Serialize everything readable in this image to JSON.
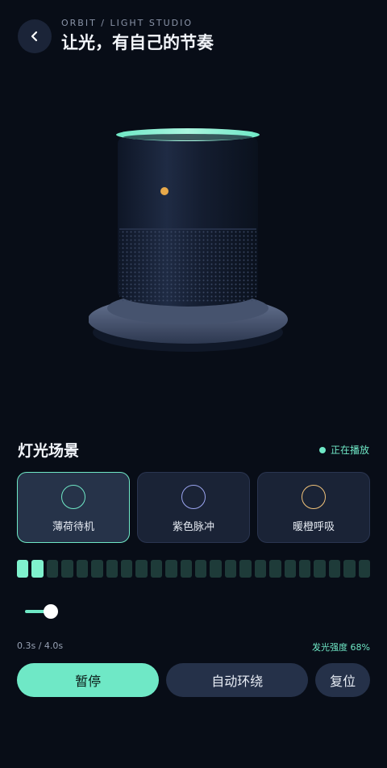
{
  "header": {
    "eyebrow": "ORBIT / LIGHT STUDIO",
    "title": "让光，有自己的节奏",
    "back_icon": "chevron-left-icon"
  },
  "colors": {
    "background": "#080d17",
    "accent": "#6fe8c6",
    "ring_mint": "#6fe8c6",
    "ring_purple": "#9aa4ef",
    "ring_amber": "#f0c27a",
    "indicator_led": "#e8a94a"
  },
  "scenes": {
    "title": "灯光场景",
    "status": "正在播放",
    "items": [
      {
        "label": "薄荷待机",
        "ring_color": "#6fe8c6",
        "active": true
      },
      {
        "label": "紫色脉冲",
        "ring_color": "#9aa4ef",
        "active": false
      },
      {
        "label": "暖橙呼吸",
        "ring_color": "#f0c27a",
        "active": false
      }
    ]
  },
  "meter": {
    "segments_total": 24,
    "segments_lit": 2
  },
  "timeline": {
    "readout": "0.3s / 4.0s",
    "position_fraction": 0.075
  },
  "intensity": {
    "label": "发光强度 68%"
  },
  "actions": {
    "pause_label": "暂停",
    "orbit_label": "自动环绕",
    "reset_label": "复位"
  }
}
